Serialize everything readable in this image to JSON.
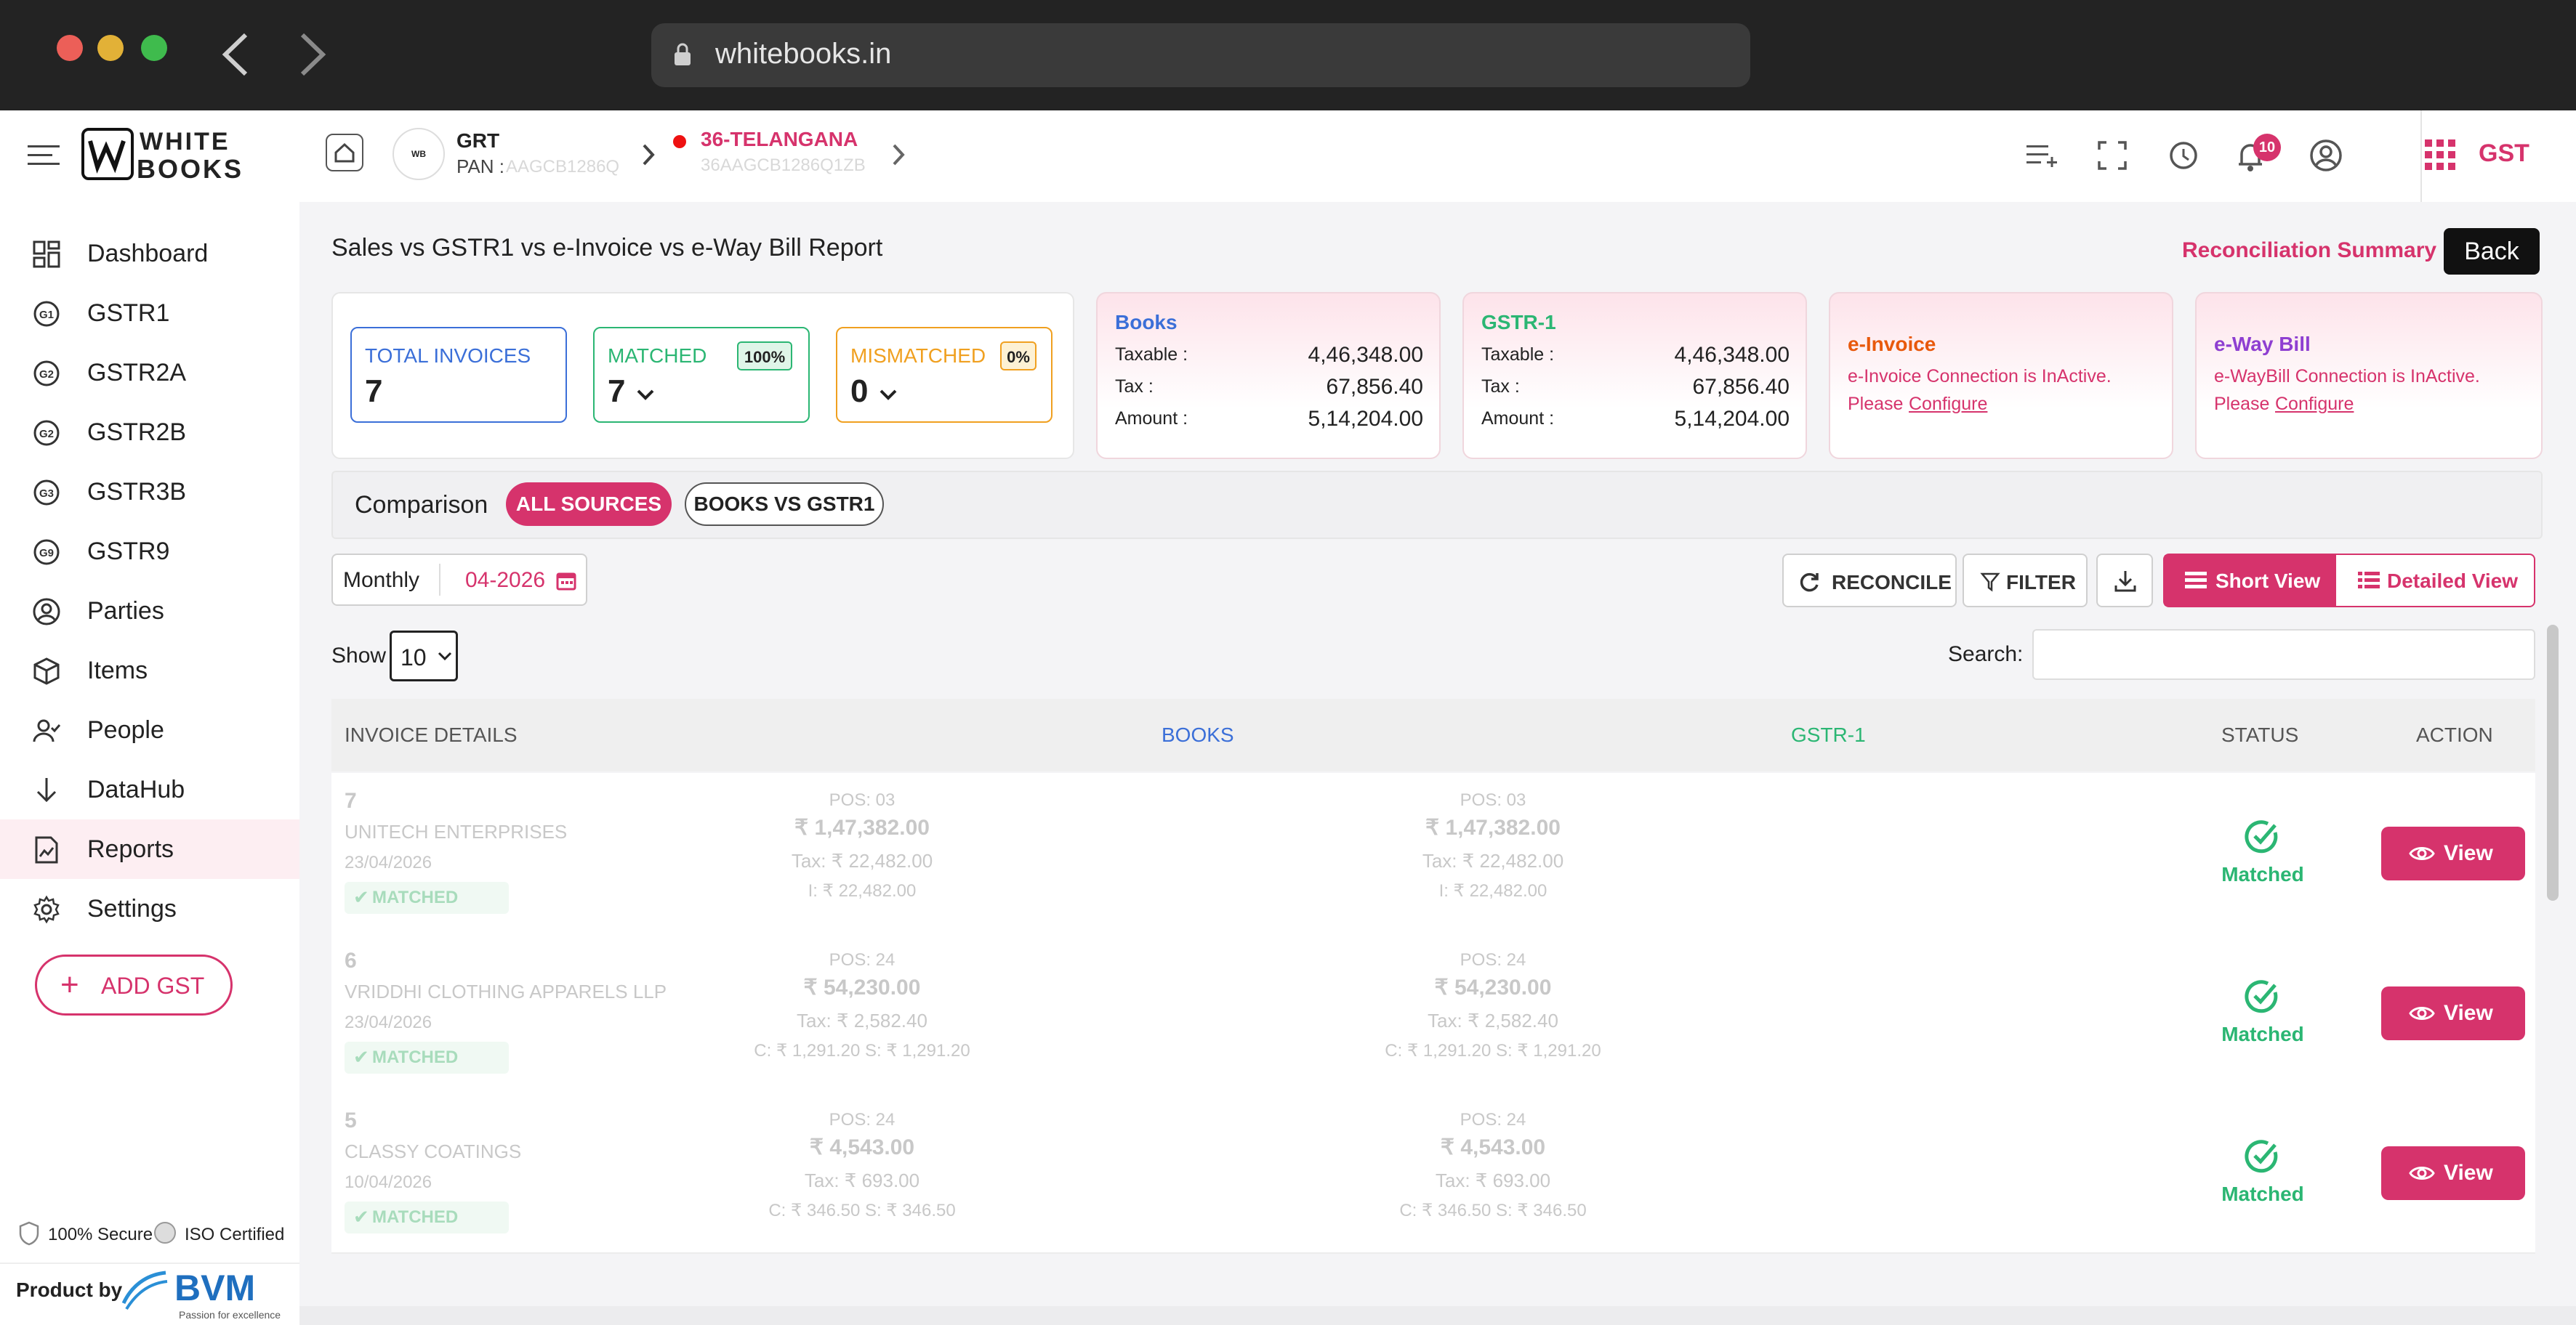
{
  "browser": {
    "url": "whitebooks.in"
  },
  "header": {
    "logo_line1": "WHITE",
    "logo_line2": "BOOKS",
    "company_name": "GRT",
    "pan_label": "PAN :",
    "pan_value": "AAGCB1286Q",
    "state_label": "36-TELANGANA",
    "gstin_value": "36AAGCB1286Q1ZB",
    "notification_count": "10",
    "module_label": "GST"
  },
  "sidebar": {
    "items": [
      {
        "label": "Dashboard",
        "icon": "dashboard-icon"
      },
      {
        "label": "GSTR1",
        "icon": "g1-icon"
      },
      {
        "label": "GSTR2A",
        "icon": "g2-icon"
      },
      {
        "label": "GSTR2B",
        "icon": "g2-icon"
      },
      {
        "label": "GSTR3B",
        "icon": "g3-icon"
      },
      {
        "label": "GSTR9",
        "icon": "g9-icon"
      },
      {
        "label": "Parties",
        "icon": "parties-icon"
      },
      {
        "label": "Items",
        "icon": "box-icon"
      },
      {
        "label": "People",
        "icon": "people-icon"
      },
      {
        "label": "DataHub",
        "icon": "download-icon"
      },
      {
        "label": "Reports",
        "icon": "reports-icon"
      },
      {
        "label": "Settings",
        "icon": "gear-icon"
      }
    ],
    "add_gst_label": "ADD GST",
    "secure_label": "100% Secure",
    "iso_label": "ISO Certified",
    "product_by": "Product by",
    "bvm_label": "BVM",
    "bvm_tagline": "Passion for excellence"
  },
  "page": {
    "title": "Sales vs GSTR1 vs e-Invoice vs e-Way Bill Report",
    "reconciliation_summary": "Reconciliation Summary",
    "back_label": "Back"
  },
  "summary": {
    "total_label": "TOTAL INVOICES",
    "total_value": "7",
    "matched_label": "MATCHED",
    "matched_pct": "100%",
    "matched_value": "7",
    "mismatched_label": "MISMATCHED",
    "mismatched_pct": "0%",
    "mismatched_value": "0"
  },
  "books_card": {
    "title": "Books",
    "taxable_label": "Taxable :",
    "taxable_value": "4,46,348.00",
    "tax_label": "Tax :",
    "tax_value": "67,856.40",
    "amount_label": "Amount :",
    "amount_value": "5,14,204.00"
  },
  "gstr1_card": {
    "title": "GSTR-1",
    "taxable_label": "Taxable :",
    "taxable_value": "4,46,348.00",
    "tax_label": "Tax :",
    "tax_value": "67,856.40",
    "amount_label": "Amount :",
    "amount_value": "5,14,204.00"
  },
  "einvoice_card": {
    "title": "e-Invoice",
    "message": "e-Invoice Connection is InActive.",
    "please": "Please",
    "configure": "Configure"
  },
  "eway_card": {
    "title": "e-Way Bill",
    "message": "e-WayBill Connection is InActive.",
    "please": "Please",
    "configure": "Configure"
  },
  "comparison": {
    "label": "Comparison",
    "tabs": [
      "ALL SOURCES",
      "BOOKS VS GSTR1"
    ]
  },
  "filters": {
    "period_type": "Monthly",
    "period_value": "04-2026",
    "reconcile_label": "RECONCILE",
    "filter_label": "FILTER",
    "short_view_label": "Short View",
    "detailed_view_label": "Detailed View",
    "show_label": "Show",
    "page_size": "10",
    "search_label": "Search:",
    "search_value": ""
  },
  "table": {
    "headers": [
      "INVOICE DETAILS",
      "BOOKS",
      "GSTR-1",
      "STATUS",
      "ACTION"
    ],
    "rows": [
      {
        "inv_no": "7",
        "party": "UNITECH ENTERPRISES",
        "date": "23/04/2026",
        "badge": "MATCHED",
        "books_pos": "POS: 03",
        "books_amount": "₹ 1,47,382.00",
        "books_tax": "Tax:  ₹ 22,482.00",
        "books_split": "I: ₹ 22,482.00",
        "gstr_pos": "POS: 03",
        "gstr_amount": "₹ 1,47,382.00",
        "gstr_tax": "Tax:  ₹ 22,482.00",
        "gstr_split": "I: ₹ 22,482.00",
        "status": "Matched",
        "action": "View"
      },
      {
        "inv_no": "6",
        "party": "VRIDDHI CLOTHING APPARELS LLP",
        "date": "23/04/2026",
        "badge": "MATCHED",
        "books_pos": "POS: 24",
        "books_amount": "₹ 54,230.00",
        "books_tax": "Tax:  ₹ 2,582.40",
        "books_split": "C: ₹ 1,291.20 S: ₹ 1,291.20",
        "gstr_pos": "POS: 24",
        "gstr_amount": "₹ 54,230.00",
        "gstr_tax": "Tax:  ₹ 2,582.40",
        "gstr_split": "C: ₹ 1,291.20 S: ₹ 1,291.20",
        "status": "Matched",
        "action": "View"
      },
      {
        "inv_no": "5",
        "party": "CLASSY COATINGS",
        "date": "10/04/2026",
        "badge": "MATCHED",
        "books_pos": "POS: 24",
        "books_amount": "₹ 4,543.00",
        "books_tax": "Tax:  ₹ 693.00",
        "books_split": "C: ₹ 346.50 S: ₹ 346.50",
        "gstr_pos": "POS: 24",
        "gstr_amount": "₹ 4,543.00",
        "gstr_tax": "Tax:  ₹ 693.00",
        "gstr_split": "C: ₹ 346.50 S: ₹ 346.50",
        "status": "Matched",
        "action": "View"
      }
    ]
  },
  "colors": {
    "accent": "#d6336c",
    "books_blue": "#3b6fd8",
    "gstr_green": "#2bb673",
    "mismatch_orange": "#f0a020",
    "einvoice_orange": "#e8590c",
    "eway_purple": "#8e3fd1"
  }
}
